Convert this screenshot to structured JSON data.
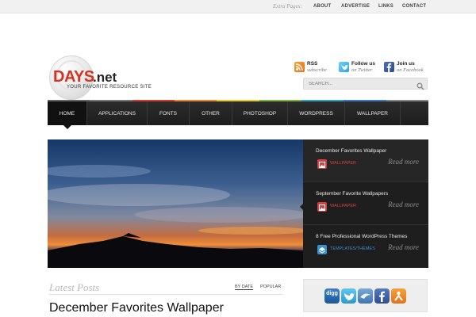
{
  "topbar": {
    "extra_label": "Extra Pages:",
    "links": [
      "ABOUT",
      "ADVERTISE",
      "LINKS",
      "CONTACT"
    ]
  },
  "logo": {
    "days": "DAYS",
    "net": ".net",
    "tagline": "YOUR FAVORITE RESOURCE SITE"
  },
  "social": [
    {
      "title": "RSS",
      "sub": "subscribe",
      "icon": "rss-icon"
    },
    {
      "title": "Follow us",
      "sub": "on Twitter",
      "icon": "twitter-icon"
    },
    {
      "title": "Join us",
      "sub": "on Facebook",
      "icon": "facebook-icon"
    }
  ],
  "search": {
    "placeholder": "SEARCH..."
  },
  "nav": {
    "items": [
      "HOME",
      "APPLICATIONS",
      "FONTS",
      "OTHER",
      "PHOTOSHOP",
      "WORDPRESS",
      "WALLPAPER"
    ]
  },
  "slider": {
    "items": [
      {
        "title": "December Favorites Wallpaper",
        "category": "WALLPAPER",
        "more": "Read more"
      },
      {
        "title": "September Favorite Wallpapers",
        "category": "WALLPAPER",
        "more": "Read more"
      },
      {
        "title": "8 Free Professional WordPress Themes",
        "category": "TEMPLATES/THEMES",
        "more": "Read more"
      }
    ]
  },
  "latest": {
    "title": "Latest Posts",
    "tabs": [
      "BY DATE",
      "POPULAR"
    ]
  },
  "post": {
    "title": "December Favorites Wallpaper"
  },
  "share": {
    "buttons": [
      "digg",
      "twitter",
      "delicious",
      "facebook",
      "stumbleupon"
    ]
  },
  "colors": {
    "accent_red": "#d7301f",
    "nav_bg": "#222222",
    "category_red": "#d64040",
    "category_blue": "#3a8fd0"
  }
}
